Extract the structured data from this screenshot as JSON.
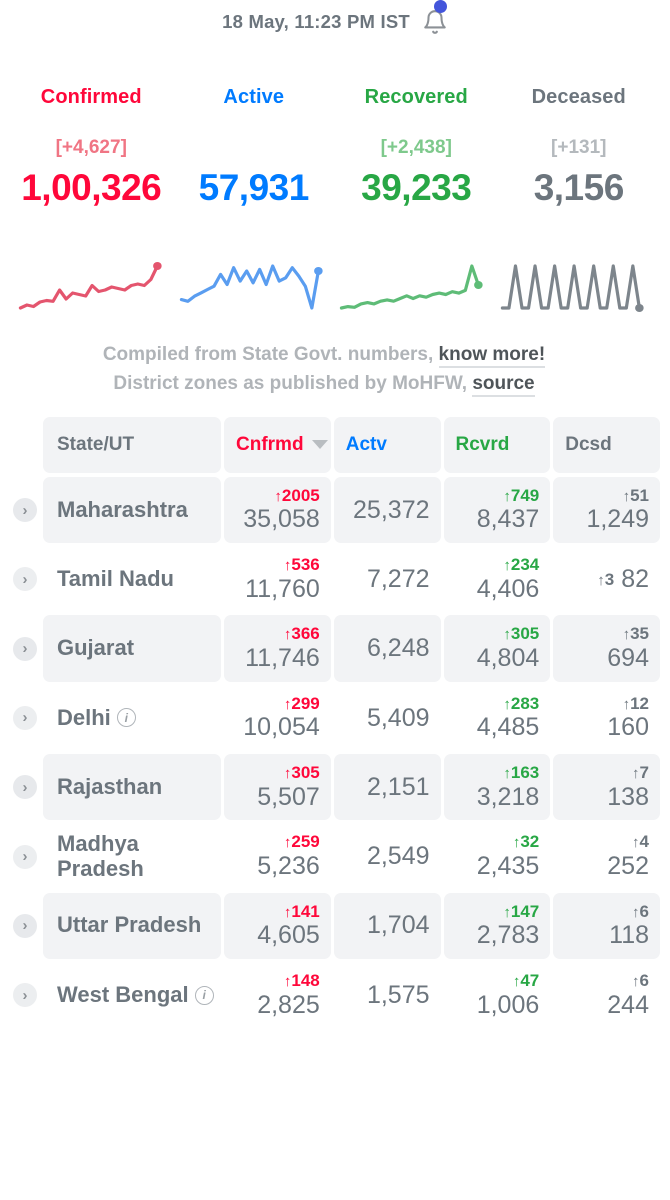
{
  "header": {
    "timestamp": "18 May, 11:23 PM IST",
    "bell_icon": "bell-icon"
  },
  "stats": [
    {
      "key": "confirmed",
      "label": "Confirmed",
      "delta": "[+4,627]",
      "value": "1,00,326",
      "color": "#ff073a"
    },
    {
      "key": "active",
      "label": "Active",
      "delta": "",
      "value": "57,931",
      "color": "#007bff"
    },
    {
      "key": "recovered",
      "label": "Recovered",
      "delta": "[+2,438]",
      "value": "39,233",
      "color": "#28a745"
    },
    {
      "key": "deceased",
      "label": "Deceased",
      "delta": "[+131]",
      "value": "3,156",
      "color": "#6c757d"
    }
  ],
  "notes": {
    "line1_text": "Compiled from State Govt. numbers,",
    "line1_link": "know more!",
    "line2_text": "District zones as published by MoHFW,",
    "line2_link": "source"
  },
  "table": {
    "headers": {
      "state": "State/UT",
      "confirmed": "Cnfrmd",
      "active": "Actv",
      "recovered": "Rcvrd",
      "deceased": "Dcsd"
    },
    "sorted_by": "Cnfrmd",
    "sort_direction": "descending",
    "rows": [
      {
        "state": "Maharashtra",
        "info": false,
        "confirmed_delta": "2005",
        "confirmed": "35,058",
        "active_delta": "",
        "active": "25,372",
        "recovered_delta": "749",
        "recovered": "8,437",
        "deceased_delta": "51",
        "deceased": "1,249",
        "deceased_inline": false
      },
      {
        "state": "Tamil Nadu",
        "info": false,
        "confirmed_delta": "536",
        "confirmed": "11,760",
        "active_delta": "",
        "active": "7,272",
        "recovered_delta": "234",
        "recovered": "4,406",
        "deceased_delta": "3",
        "deceased": "82",
        "deceased_inline": true
      },
      {
        "state": "Gujarat",
        "info": false,
        "confirmed_delta": "366",
        "confirmed": "11,746",
        "active_delta": "",
        "active": "6,248",
        "recovered_delta": "305",
        "recovered": "4,804",
        "deceased_delta": "35",
        "deceased": "694",
        "deceased_inline": false
      },
      {
        "state": "Delhi",
        "info": true,
        "confirmed_delta": "299",
        "confirmed": "10,054",
        "active_delta": "",
        "active": "5,409",
        "recovered_delta": "283",
        "recovered": "4,485",
        "deceased_delta": "12",
        "deceased": "160",
        "deceased_inline": false
      },
      {
        "state": "Rajasthan",
        "info": false,
        "confirmed_delta": "305",
        "confirmed": "5,507",
        "active_delta": "",
        "active": "2,151",
        "recovered_delta": "163",
        "recovered": "3,218",
        "deceased_delta": "7",
        "deceased": "138",
        "deceased_inline": false
      },
      {
        "state": "Madhya Pradesh",
        "info": false,
        "confirmed_delta": "259",
        "confirmed": "5,236",
        "active_delta": "",
        "active": "2,549",
        "recovered_delta": "32",
        "recovered": "2,435",
        "deceased_delta": "4",
        "deceased": "252",
        "deceased_inline": false
      },
      {
        "state": "Uttar Pradesh",
        "info": false,
        "confirmed_delta": "141",
        "confirmed": "4,605",
        "active_delta": "",
        "active": "1,704",
        "recovered_delta": "147",
        "recovered": "2,783",
        "deceased_delta": "6",
        "deceased": "118",
        "deceased_inline": false
      },
      {
        "state": "West Bengal",
        "info": true,
        "confirmed_delta": "148",
        "confirmed": "2,825",
        "active_delta": "",
        "active": "1,575",
        "recovered_delta": "47",
        "recovered": "1,006",
        "deceased_delta": "6",
        "deceased": "244",
        "deceased_inline": false
      }
    ]
  },
  "chart_data": [
    {
      "type": "line",
      "title": "Confirmed trend",
      "series_name": "confirmed",
      "color": "#e4556e",
      "values": [
        14,
        18,
        16,
        22,
        24,
        23,
        38,
        26,
        34,
        32,
        30,
        44,
        36,
        38,
        42,
        40,
        38,
        44,
        46,
        44,
        52,
        70
      ]
    },
    {
      "type": "line",
      "title": "Active trend",
      "series_name": "active",
      "color": "#5a9df0",
      "values": [
        18,
        16,
        22,
        26,
        30,
        34,
        48,
        36,
        56,
        40,
        52,
        38,
        54,
        36,
        58,
        40,
        44,
        56,
        46,
        34,
        8,
        52
      ]
    },
    {
      "type": "line",
      "title": "Recovered trend",
      "series_name": "recovered",
      "color": "#5ebc77",
      "values": [
        12,
        14,
        13,
        18,
        20,
        18,
        22,
        24,
        22,
        26,
        30,
        26,
        30,
        28,
        32,
        34,
        32,
        36,
        34,
        38,
        74,
        46
      ]
    },
    {
      "type": "line",
      "title": "Deceased trend",
      "series_name": "deceased",
      "color": "#7d858c",
      "values": [
        10,
        10,
        11,
        10,
        10,
        11,
        10,
        10,
        11,
        10,
        10,
        11,
        10,
        10,
        11,
        10,
        10,
        11,
        10,
        10,
        11,
        10
      ]
    }
  ]
}
